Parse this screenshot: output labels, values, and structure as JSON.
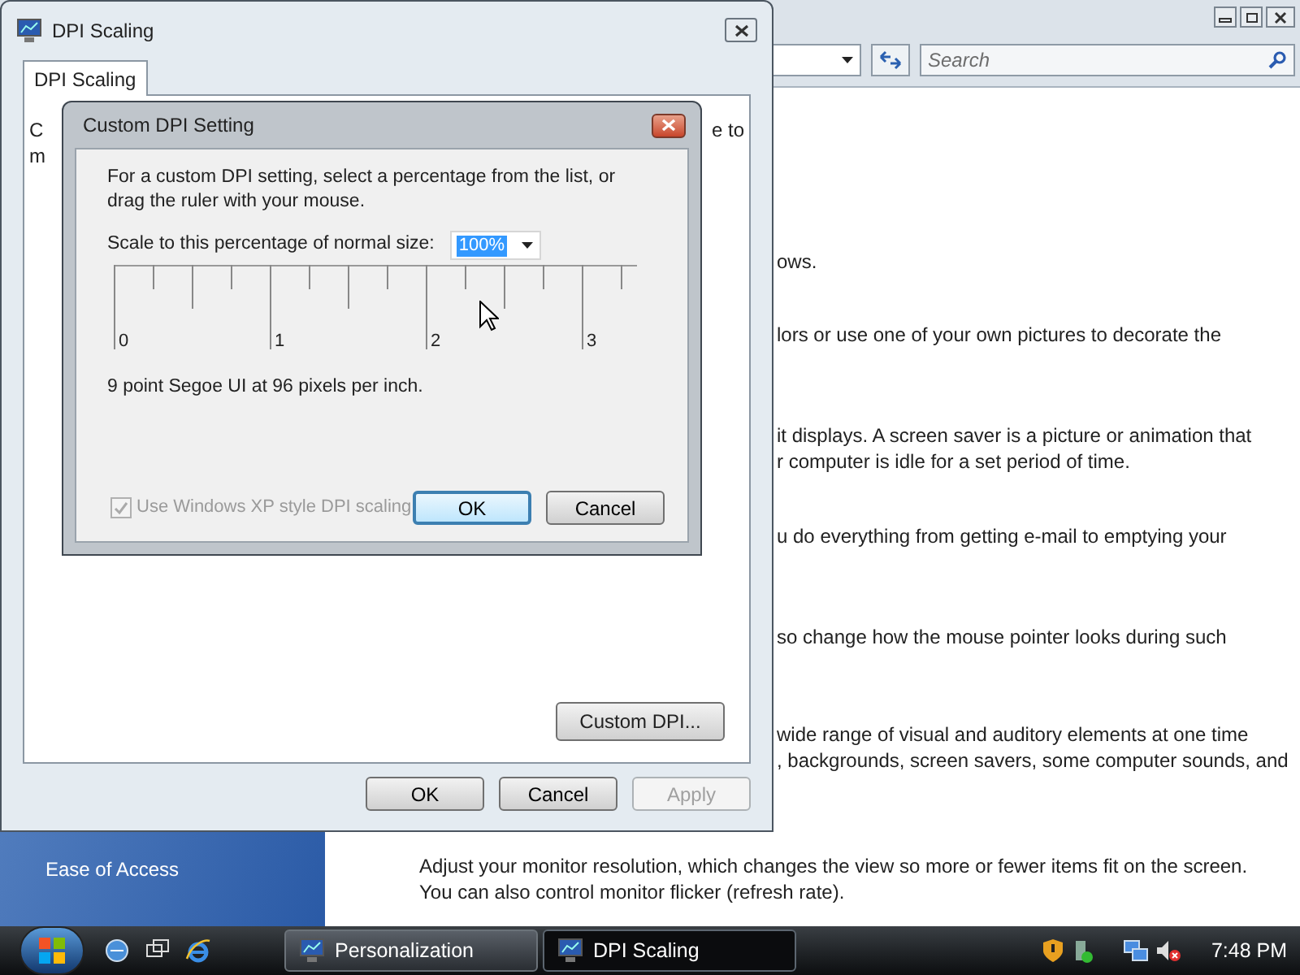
{
  "background_window": {
    "search": {
      "placeholder": "Search"
    },
    "content_blocks": [
      [
        "ows."
      ],
      [
        "lors or use one of your own pictures to decorate the"
      ],
      [
        "it displays. A screen saver is a picture or animation that",
        "r computer is idle for a set period of time."
      ],
      [
        "u do everything from getting e-mail to emptying your"
      ],
      [
        "so change how the mouse pointer looks during such"
      ],
      [
        "wide range of visual and auditory elements at one time",
        ", backgrounds, screen savers, some computer sounds, and"
      ]
    ],
    "description": [
      "Adjust your monitor resolution, which changes the view so more or fewer items fit on the screen.",
      "You can also control monitor flicker (refresh rate)."
    ],
    "sidebar_items": [
      "Ease of Access"
    ]
  },
  "dpi_window": {
    "title": "DPI Scaling",
    "tabs": [
      {
        "label": "DPI Scaling",
        "selected": true
      }
    ],
    "text_fragments": [
      "C",
      "m",
      "e to"
    ],
    "custom_button": "Custom DPI...",
    "buttons": [
      {
        "label": "OK",
        "disabled": false
      },
      {
        "label": "Cancel",
        "disabled": false
      },
      {
        "label": "Apply",
        "disabled": true
      }
    ]
  },
  "dialog": {
    "title": "Custom DPI Setting",
    "instructions": [
      "For a custom DPI setting, select a percentage from the list, or",
      "drag the ruler with your mouse."
    ],
    "scale_label": "Scale to this percentage of normal size:",
    "scale_value": "100%",
    "ruler_labels": [
      "0",
      "1",
      "2",
      "3"
    ],
    "font_info": "9 point Segoe UI at 96 pixels per inch.",
    "xp_checkbox": {
      "label": "Use Windows XP style DPI scaling",
      "checked": true,
      "disabled": true
    },
    "buttons": [
      {
        "label": "OK",
        "default": true
      },
      {
        "label": "Cancel",
        "default": false
      }
    ]
  },
  "taskbar": {
    "buttons": [
      {
        "label": "Personalization",
        "selected": false
      },
      {
        "label": "DPI Scaling",
        "selected": true
      }
    ],
    "clock": "7:48 PM"
  }
}
